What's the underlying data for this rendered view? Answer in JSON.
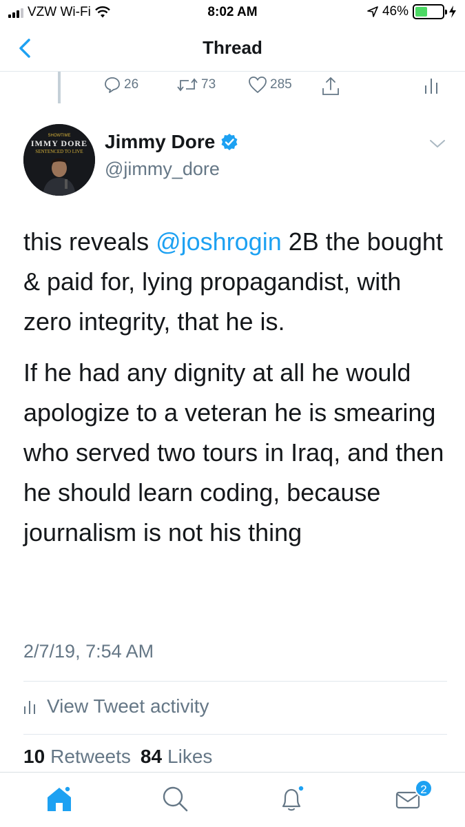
{
  "status_bar": {
    "carrier": "VZW Wi-Fi",
    "time": "8:02 AM",
    "battery_percent": "46%",
    "battery_level": 0.46,
    "icons": [
      "signal-icon",
      "wifi-icon",
      "location-arrow-icon",
      "battery-icon",
      "charging-icon"
    ]
  },
  "nav": {
    "back_icon": "chevron-left-icon",
    "title": "Thread"
  },
  "prev_tweet_actions": {
    "replies": "26",
    "retweets": "73",
    "likes": "285"
  },
  "tweet": {
    "author_name": "Jimmy Dore",
    "handle": "@jimmy_dore",
    "verified": true,
    "avatar_text": "IMMY DORE",
    "avatar_subtext": "SENTENCED TO LIVE",
    "text_part1": "this reveals ",
    "mention": "@joshrogin",
    "text_part2": " 2B the bought & paid for,  lying propagandist, with zero integrity, that he is.",
    "paragraph2": "If he had any dignity at all he would apologize to a veteran he is smearing who served two tours in Iraq, and then he should learn coding, because journalism is not his thing",
    "timestamp": "2/7/19, 7:54 AM"
  },
  "activity": {
    "label": "View Tweet activity"
  },
  "stats": {
    "retweets_count": "10",
    "retweets_label": "Retweets",
    "likes_count": "84",
    "likes_label": "Likes"
  },
  "tabbar": {
    "tabs": [
      "home-icon",
      "search-icon",
      "notifications-icon",
      "messages-icon"
    ],
    "messages_badge": "2"
  },
  "colors": {
    "accent": "#1da1f2",
    "secondary_text": "#657786",
    "primary_text": "#14171a",
    "battery_green": "#4cd964"
  }
}
